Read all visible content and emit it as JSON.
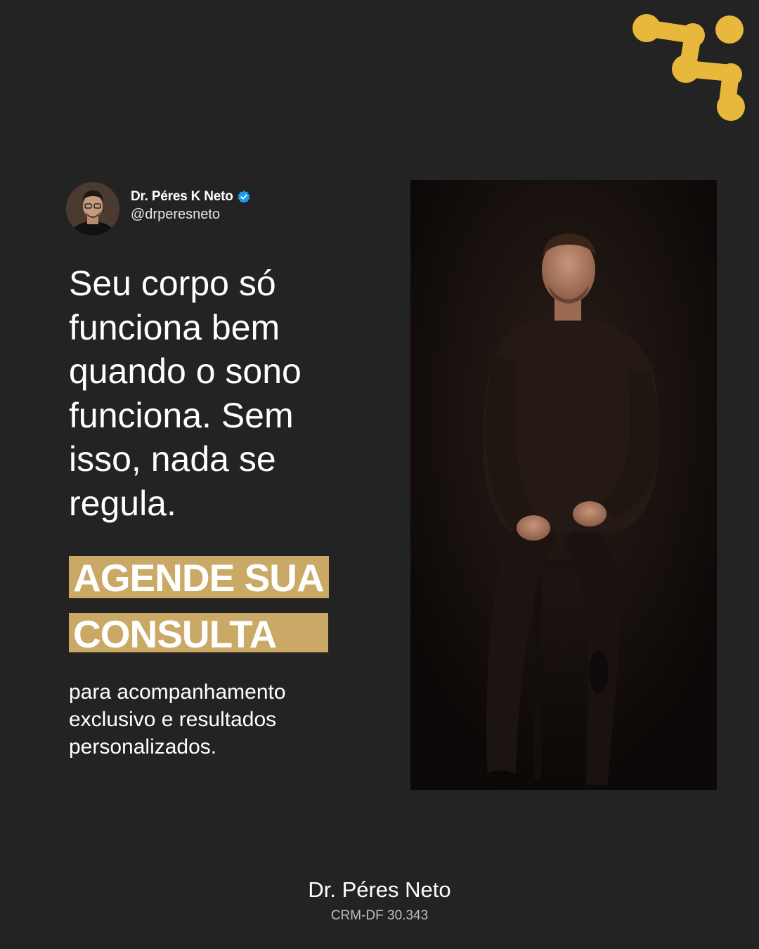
{
  "colors": {
    "background": "#232323",
    "accent_gold": "#c9a965",
    "logo_gold": "#e8b83c",
    "verified_blue": "#1d9bf0"
  },
  "brand": {
    "logo_icon": "molecule-logo-icon"
  },
  "profile": {
    "name": "Dr. Péres K Neto",
    "handle": "@drperesneto",
    "verified_icon": "verified-badge-icon"
  },
  "headline": {
    "lines": [
      "Seu corpo só",
      "funciona bem",
      "quando o sono",
      "funciona. Sem",
      "isso, nada se",
      "regula."
    ]
  },
  "cta": {
    "line1": "AGENDE SUA",
    "line2": "CONSULTA"
  },
  "subtext": {
    "lines": [
      "para acompanhamento",
      "exclusivo e resultados",
      "personalizados."
    ]
  },
  "footer": {
    "name": "Dr. Péres Neto",
    "crm": "CRM-DF 30.343"
  }
}
